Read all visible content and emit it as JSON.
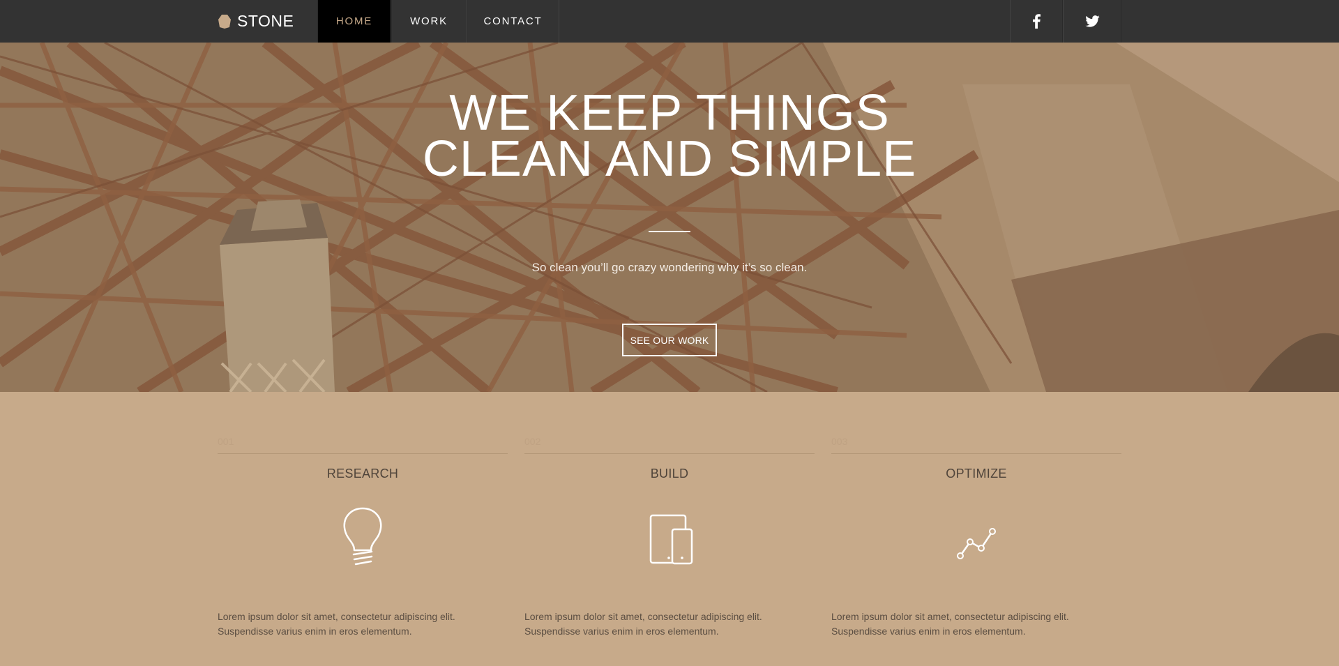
{
  "brand": {
    "name": "STONE",
    "icon": "stone-logo-icon"
  },
  "nav": {
    "items": [
      {
        "label": "HOME",
        "active": true
      },
      {
        "label": "WORK",
        "active": false
      },
      {
        "label": "CONTACT",
        "active": false
      }
    ],
    "social": [
      {
        "icon": "facebook-icon"
      },
      {
        "icon": "twitter-icon"
      }
    ]
  },
  "hero": {
    "title_line1": "WE KEEP THINGS",
    "title_line2": "CLEAN AND SIMPLE",
    "subtitle": "So clean you’ll go crazy wondering why it’s so clean.",
    "button_label": "SEE OUR WORK"
  },
  "features": [
    {
      "number": "001",
      "title": "RESEARCH",
      "icon": "lightbulb-icon",
      "text": "Lorem ipsum dolor sit amet, consectetur adipiscing elit. Suspendisse varius enim in eros elementum."
    },
    {
      "number": "002",
      "title": "BUILD",
      "icon": "devices-icon",
      "text": "Lorem ipsum dolor sit amet, consectetur adipiscing elit. Suspendisse varius enim in eros elementum."
    },
    {
      "number": "003",
      "title": "OPTIMIZE",
      "icon": "line-chart-icon",
      "text": "Lorem ipsum dolor sit amet, consectetur adipiscing elit. Suspendisse varius enim in eros elementum."
    }
  ],
  "colors": {
    "nav_background": "#333333",
    "accent": "#c7aa8a",
    "section_background": "#c7aa8a",
    "active_nav_background": "#000000"
  }
}
